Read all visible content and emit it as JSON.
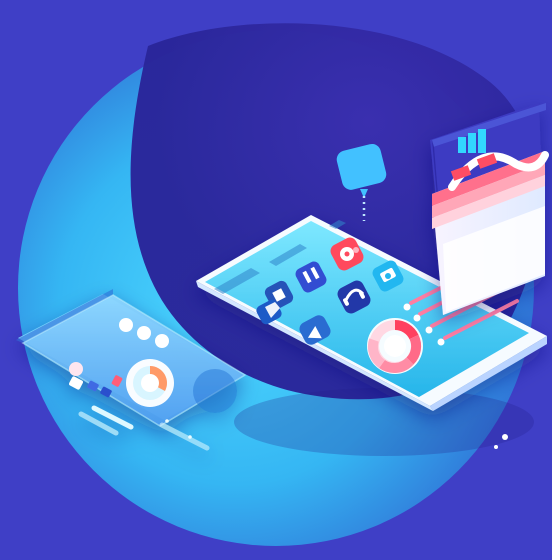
{
  "scene": {
    "background": "#3f3fc6",
    "disc_light": "#39b8f2",
    "disc_dark": "#2f2aa7",
    "shadow": "#241e8e",
    "accent_red": "#ff4a5d",
    "accent_pink": "#ff6a88"
  },
  "icons": [
    {
      "name": "stop-icon"
    },
    {
      "name": "pause-icon"
    },
    {
      "name": "settings-icon"
    },
    {
      "name": "headphones-icon"
    },
    {
      "name": "camera-icon"
    },
    {
      "name": "video-icon"
    },
    {
      "name": "shield-icon"
    },
    {
      "name": "chart-icon"
    }
  ],
  "illustration": {
    "donut_ring": "#ff5b7a",
    "donut_ring_alt": "#ffd8e3",
    "donut_highlight": "#ff3f5f"
  }
}
